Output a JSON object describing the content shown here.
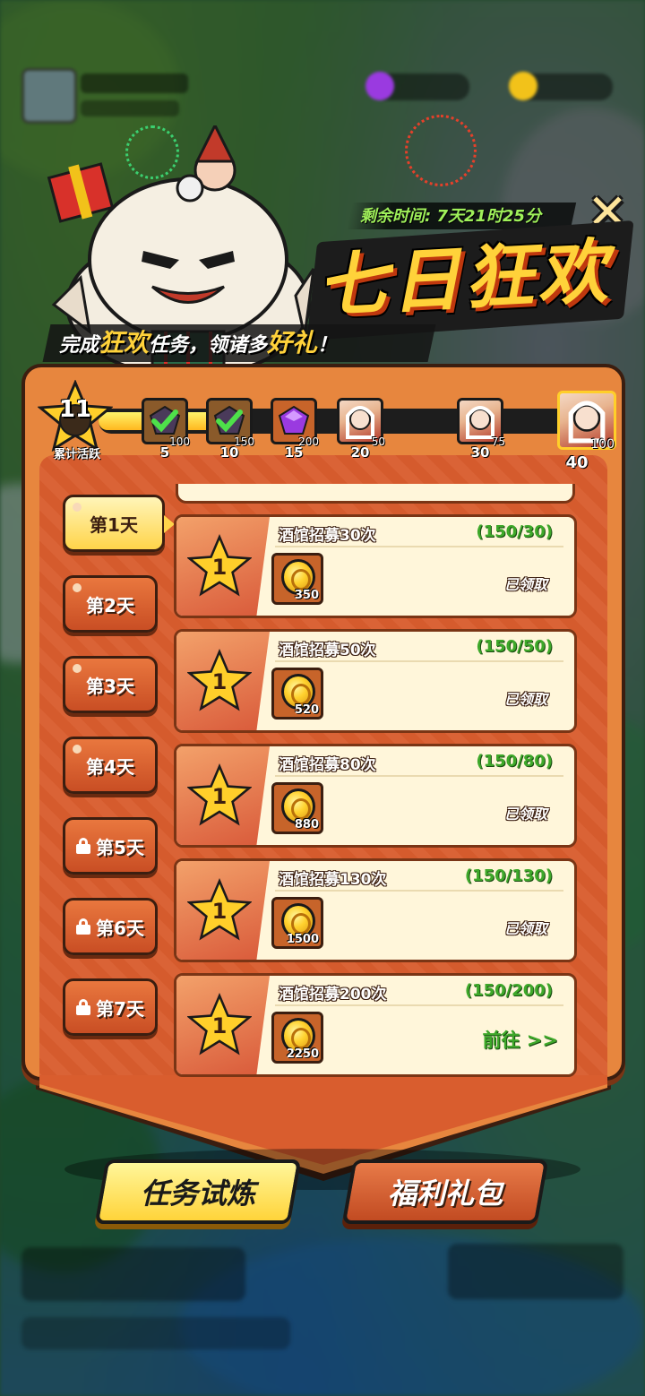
{
  "header": {
    "remaining_time": "剩余时间: 7天21时25分",
    "title": "七日狂欢",
    "subtitle_parts": [
      "完成",
      "狂欢",
      "任务，领诸多",
      "好礼",
      "！"
    ],
    "close_icon": "close-x-icon"
  },
  "progress": {
    "activity_value": "11",
    "activity_label": "累计活跃",
    "current": 11,
    "max": 40,
    "milestones": [
      {
        "need": "5",
        "count": "100",
        "icon": "gem-claimed-icon"
      },
      {
        "need": "10",
        "count": "150",
        "icon": "gem-claimed-icon"
      },
      {
        "need": "15",
        "count": "200",
        "icon": "purple-gem-icon"
      },
      {
        "need": "20",
        "count": "50",
        "icon": "hero-portrait-icon"
      },
      {
        "need": "30",
        "count": "75",
        "icon": "hero-portrait-icon"
      },
      {
        "need": "40",
        "count": "100",
        "icon": "hero-portrait-icon"
      }
    ]
  },
  "days": [
    {
      "label": "第1天",
      "locked": false,
      "active": true
    },
    {
      "label": "第2天",
      "locked": false,
      "active": false
    },
    {
      "label": "第3天",
      "locked": false,
      "active": false
    },
    {
      "label": "第4天",
      "locked": false,
      "active": false
    },
    {
      "label": "第5天",
      "locked": true,
      "active": false
    },
    {
      "label": "第6天",
      "locked": true,
      "active": false
    },
    {
      "label": "第7天",
      "locked": true,
      "active": false
    }
  ],
  "tasks": [
    {
      "points": "1",
      "name": "酒馆招募30次",
      "progress": "(150/30)",
      "reward": "350",
      "status": "已领取",
      "goto": ""
    },
    {
      "points": "1",
      "name": "酒馆招募50次",
      "progress": "(150/50)",
      "reward": "520",
      "status": "已领取",
      "goto": ""
    },
    {
      "points": "1",
      "name": "酒馆招募80次",
      "progress": "(150/80)",
      "reward": "880",
      "status": "已领取",
      "goto": ""
    },
    {
      "points": "1",
      "name": "酒馆招募130次",
      "progress": "(150/130)",
      "reward": "1500",
      "status": "已领取",
      "goto": ""
    },
    {
      "points": "1",
      "name": "酒馆招募200次",
      "progress": "(150/200)",
      "reward": "2250",
      "status": "",
      "goto": "前往 >>"
    }
  ],
  "buttons": {
    "task_trial": "任务试炼",
    "welfare_pack": "福利礼包"
  },
  "colors": {
    "accent_yellow": "#ffd23a",
    "panel_orange": "#e7863e",
    "panel_inner": "#d95d2e",
    "progress_green": "#3ea82a",
    "timer_green": "#9ff05a"
  }
}
